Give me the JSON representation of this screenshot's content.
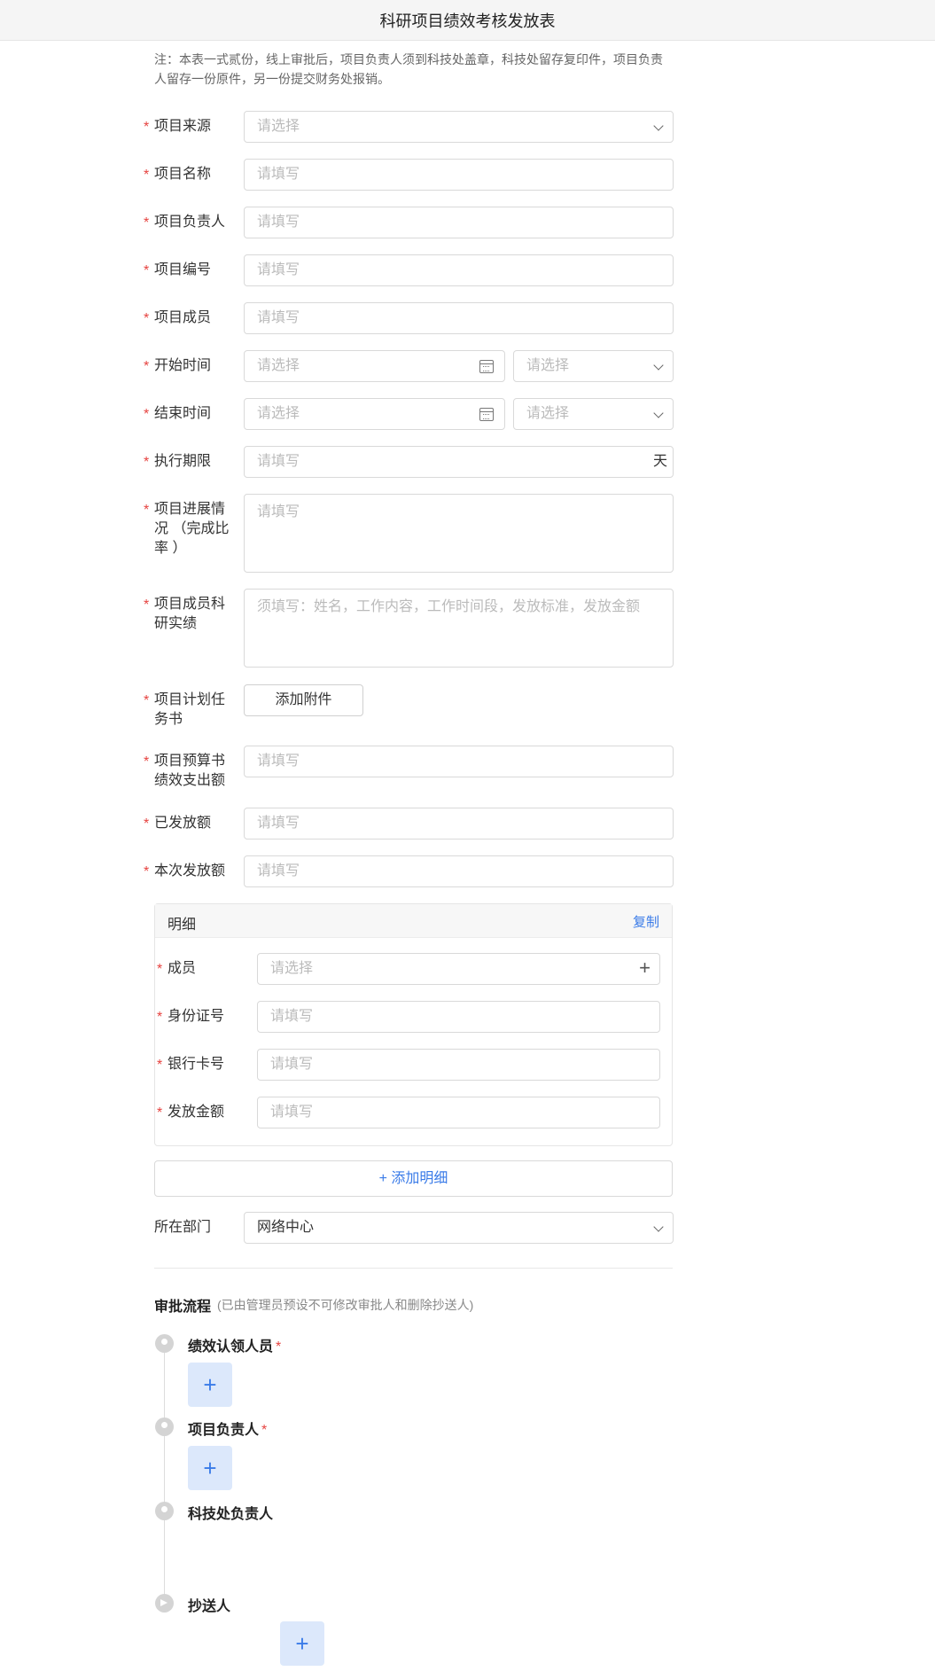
{
  "header": {
    "title": "科研项目绩效考核发放表"
  },
  "note": "注：本表一式贰份，线上审批后，项目负责人须到科技处盖章，科技处留存复印件，项目负责人留存一份原件，另一份提交财务处报销。",
  "fields": {
    "source": {
      "label": "项目来源",
      "placeholder": "请选择"
    },
    "name": {
      "label": "项目名称",
      "placeholder": "请填写"
    },
    "leader": {
      "label": "项目负责人",
      "placeholder": "请填写"
    },
    "number": {
      "label": "项目编号",
      "placeholder": "请填写"
    },
    "members": {
      "label": "项目成员",
      "placeholder": "请填写"
    },
    "start": {
      "label": "开始时间",
      "date_placeholder": "请选择",
      "time_placeholder": "请选择"
    },
    "end": {
      "label": "结束时间",
      "date_placeholder": "请选择",
      "time_placeholder": "请选择"
    },
    "period": {
      "label": "执行期限",
      "placeholder": "请填写",
      "unit": "天"
    },
    "progress": {
      "label": "项目进展情况 （完成比率 ）",
      "placeholder": "请填写"
    },
    "achievements": {
      "label": "项目成员科研实绩",
      "placeholder": "须填写：姓名，工作内容，工作时间段，发放标准，发放金额"
    },
    "task_book": {
      "label": "项目计划任务书",
      "button": "添加附件"
    },
    "budget": {
      "label": "项目预算书绩效支出额",
      "placeholder": "请填写"
    },
    "issued": {
      "label": "已发放额",
      "placeholder": "请填写"
    },
    "current": {
      "label": "本次发放额",
      "placeholder": "请填写"
    },
    "department": {
      "label": "所在部门",
      "value": "网络中心"
    }
  },
  "detail": {
    "title": "明细",
    "copy": "复制",
    "member": {
      "label": "成员",
      "placeholder": "请选择"
    },
    "id_number": {
      "label": "身份证号",
      "placeholder": "请填写"
    },
    "bank_card": {
      "label": "银行卡号",
      "placeholder": "请填写"
    },
    "amount": {
      "label": "发放金额",
      "placeholder": "请填写"
    },
    "add": "+ 添加明细"
  },
  "approval": {
    "title": "审批流程",
    "subtitle": "(已由管理员预设不可修改审批人和删除抄送人)",
    "nodes": [
      {
        "name": "绩效认领人员",
        "required": "*"
      },
      {
        "name": "项目负责人",
        "required": "*"
      },
      {
        "name": "科技处负责人"
      },
      {
        "name": "抄送人"
      }
    ],
    "add_symbol": "+"
  },
  "required_mark": "*",
  "colors": {
    "accent": "#3a7be8",
    "required": "#e64340",
    "add_bg": "#dce8fb"
  }
}
